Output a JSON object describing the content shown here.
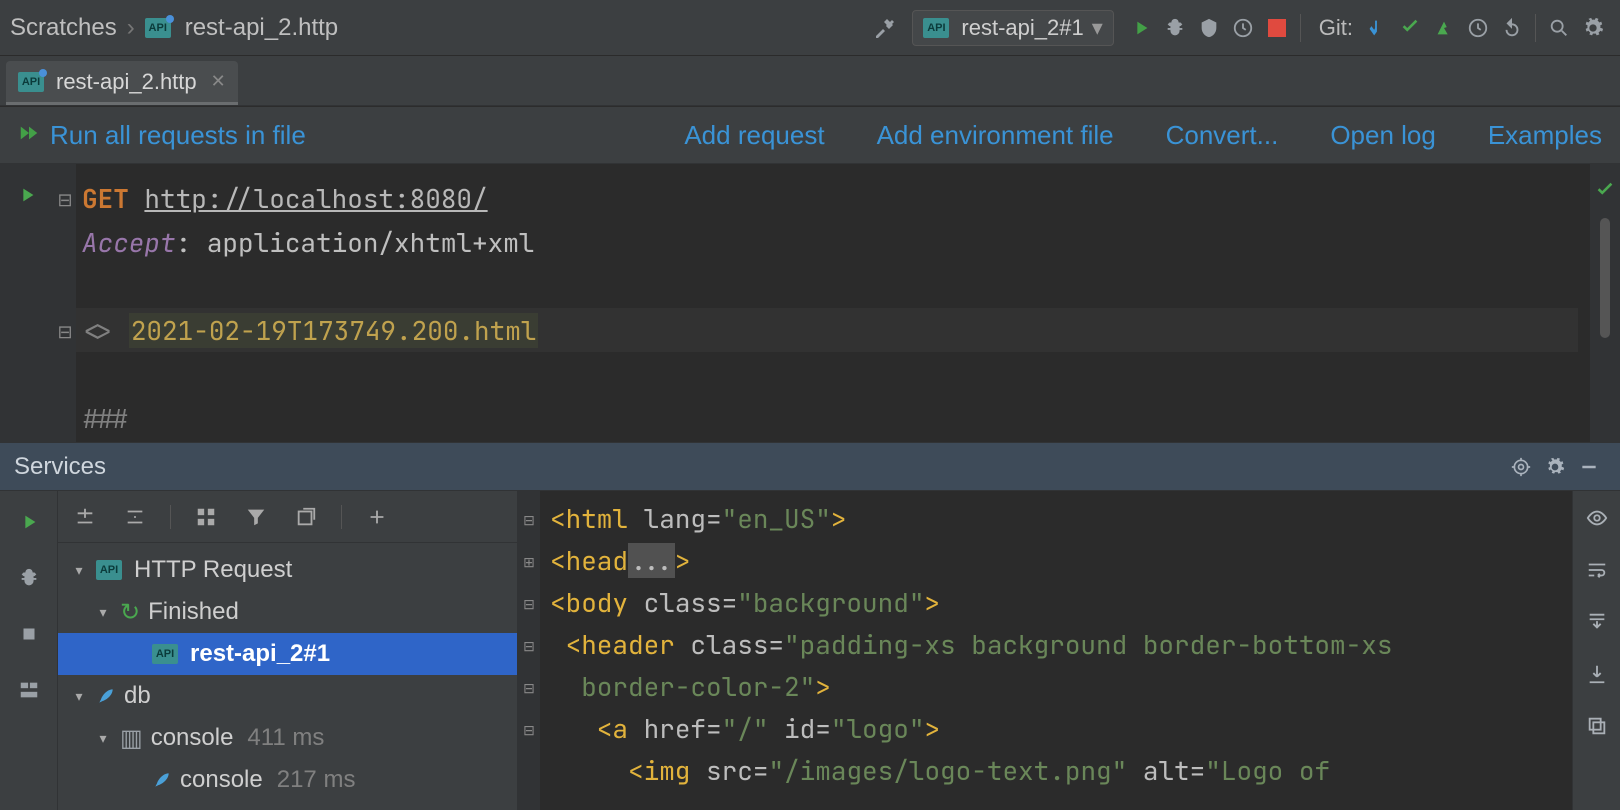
{
  "breadcrumb": {
    "root": "Scratches",
    "file": "rest-api_2.http"
  },
  "runConfig": {
    "label": "rest-api_2#1"
  },
  "git": {
    "label": "Git:"
  },
  "tab": {
    "label": "rest-api_2.http"
  },
  "editorActions": {
    "runAll": "Run all requests in file",
    "addRequest": "Add request",
    "addEnv": "Add environment file",
    "convert": "Convert...",
    "openLog": "Open log",
    "examples": "Examples"
  },
  "editor": {
    "method": "GET",
    "url": "http://localhost:8080/",
    "headerName": "Accept",
    "headerValue": "application/xhtml+xml",
    "respPrefix": "<>",
    "respFile": "2021-02-19T173749.200.html",
    "terminator": "###"
  },
  "servicesPanel": {
    "title": "Services",
    "tree": {
      "httpRequest": "HTTP Request",
      "finished": "Finished",
      "runItem": "rest-api_2#1",
      "db": "db",
      "console": "console",
      "console_ms": "411 ms",
      "console2": "console",
      "console2_ms": "217 ms"
    }
  },
  "response": {
    "l1_pre": "<",
    "l1_tag": "html",
    "l1_attr": " lang=",
    "l1_str": "\"en_US\"",
    "l1_post": ">",
    "l2_pre": "<",
    "l2_tag": "head",
    "l2_dots": "...",
    "l2_post": ">",
    "l3_pre": "<",
    "l3_tag": "body",
    "l3_attr": " class=",
    "l3_str": "\"background\"",
    "l3_post": ">",
    "l4_pre": " <",
    "l4_tag": "header",
    "l4_attr": " class=",
    "l4_str": "\"padding-xs background border-bottom-xs",
    "l5_str": "  border-color-2\"",
    "l5_post": ">",
    "l6_pre": "   <",
    "l6_tag": "a",
    "l6_a1": " href=",
    "l6_s1": "\"/\"",
    "l6_a2": " id=",
    "l6_s2": "\"logo\"",
    "l6_post": ">",
    "l7_pre": "     <",
    "l7_tag": "img",
    "l7_a1": " src=",
    "l7_s1": "\"/images/logo-text.png\"",
    "l7_a2": " alt=",
    "l7_s2": "\"Logo of"
  }
}
